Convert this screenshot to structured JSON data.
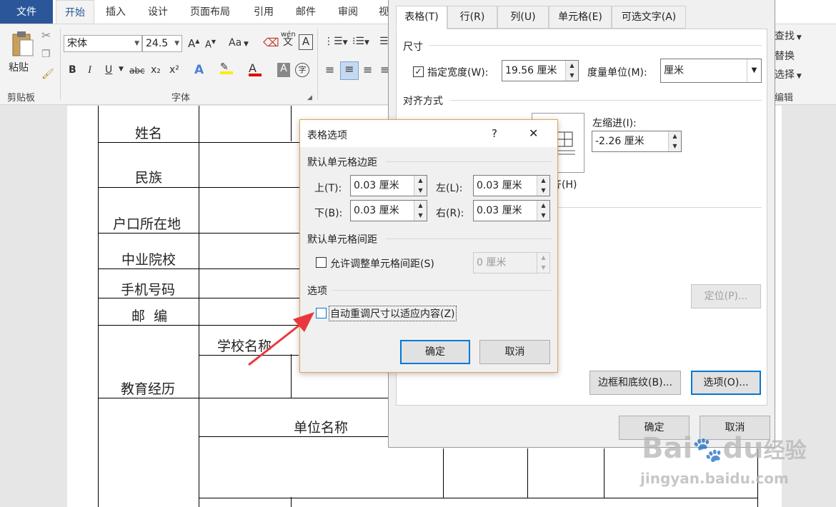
{
  "ribbon": {
    "tabs": [
      "文件",
      "开始",
      "插入",
      "设计",
      "页面布局",
      "引用",
      "邮件",
      "审阅",
      "视"
    ],
    "clipboard": {
      "paste": "粘贴",
      "label": "剪贴板"
    },
    "font": {
      "name": "宋体",
      "size": "24.5",
      "label": "字体",
      "aa": "Aa",
      "wen": "wén",
      "wen_char": "文",
      "a_box": "A",
      "bold": "B",
      "italic": "I",
      "underline": "U",
      "strike": "abc",
      "sub": "x₂",
      "sup": "x²",
      "a_font": "A",
      "enclose": "字"
    },
    "editing": {
      "find": "查找",
      "replace": "替换",
      "select": "选择",
      "label": "编辑"
    }
  },
  "document": {
    "rows": [
      "姓名",
      "民族",
      "户口所在地",
      "中业院校",
      "手机号码",
      "邮  编",
      "教育经历"
    ],
    "school_name": "学校名称",
    "unit_name": "单位名称"
  },
  "table_properties": {
    "tabs": [
      "表格(T)",
      "行(R)",
      "列(U)",
      "单元格(E)",
      "可选文字(A)"
    ],
    "size_section": "尺寸",
    "preferred_width_label": "指定宽度(W):",
    "preferred_width_checked": true,
    "preferred_width_value": "19.56 厘米",
    "measure_in_label": "度量单位(M):",
    "measure_in_value": "厘米",
    "alignment_section": "对齐方式",
    "indent_label": "左缩进(I):",
    "indent_value": "-2.26 厘米",
    "align_right_partial": "齐(H)",
    "positioning_button": "定位(P)...",
    "borders_button": "边框和底纹(B)...",
    "options_button": "选项(O)...",
    "ok_button": "确定",
    "cancel_button": "取消"
  },
  "table_options": {
    "title": "表格选项",
    "help": "?",
    "close": "✕",
    "margins_section": "默认单元格边距",
    "top_label": "上(T):",
    "top_value": "0.03 厘米",
    "left_label": "左(L):",
    "left_value": "0.03 厘米",
    "bottom_label": "下(B):",
    "bottom_value": "0.03 厘米",
    "right_label": "右(R):",
    "right_value": "0.03 厘米",
    "spacing_section": "默认单元格间距",
    "allow_spacing_label": "允许调整单元格间距(S)",
    "allow_spacing_checked": false,
    "spacing_value": "0 厘米",
    "options_section": "选项",
    "autoresize_label": "自动重调尺寸以适应内容(Z)",
    "autoresize_checked": false,
    "ok_button": "确定",
    "cancel_button": "取消"
  },
  "watermark": {
    "brand": "Bai",
    "du": "du",
    "jingyan": "经验",
    "url": "jingyan.baidu.com"
  },
  "colors": {
    "accent": "#2b579a",
    "focus": "#0078d7",
    "arrow": "#e8383d",
    "dialog_border": "#e4a350"
  }
}
